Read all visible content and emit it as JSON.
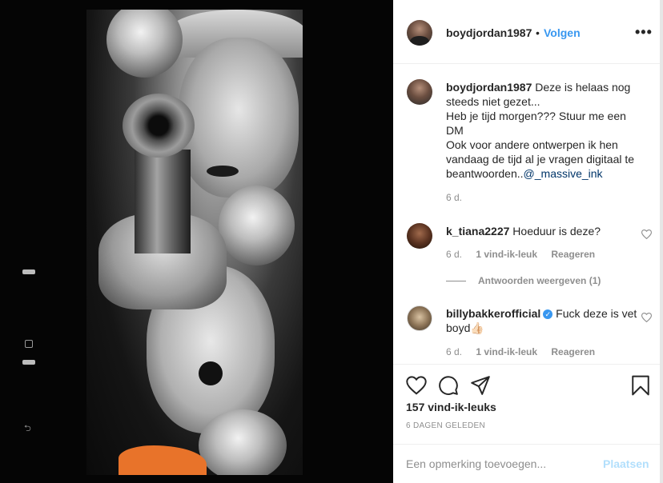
{
  "post": {
    "author": "boydjordan1987",
    "separator": "•",
    "follow_label": "Volgen",
    "more_label": "•••"
  },
  "comments": [
    {
      "user": "boydjordan1987",
      "text": "Deze is helaas nog steeds niet gezet...\nHeb je tijd morgen??? Stuur me een DM\nOok voor andere ontwerpen ik hen vandaag de tijd al je vragen digitaal te beantwoorden..",
      "mention": "@_massive_ink",
      "age": "6 d."
    },
    {
      "user": "k_tiana2227",
      "text": "Hoeduur is deze?",
      "age": "6 d.",
      "likes": "1 vind-ik-leuk",
      "reply_label": "Reageren",
      "replies_label": "Antwoorden weergeven (1)"
    },
    {
      "user": "billybakkerofficial",
      "verified": "✓",
      "text": "Fuck deze is vet boyd👍🏻",
      "age": "6 d.",
      "likes": "1 vind-ik-leuk",
      "reply_label": "Reageren"
    }
  ],
  "actions": {
    "likes_count": "157 vind-ik-leuks",
    "timestamp": "6 DAGEN GELEDEN",
    "icons": [
      "heart-icon",
      "comment-icon",
      "share-icon",
      "bookmark-icon"
    ]
  },
  "comment_box": {
    "placeholder": "Een opmerking toevoegen...",
    "post_label": "Plaatsen"
  },
  "colors": {
    "link_blue": "#3897f0",
    "post_disabled": "#b2dffc",
    "muted": "#8e8e8e",
    "text": "#262626"
  }
}
